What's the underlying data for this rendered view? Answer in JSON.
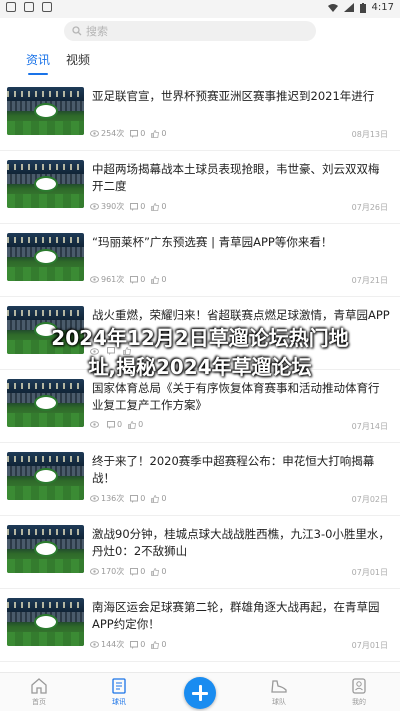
{
  "statusbar": {
    "time": "4:17"
  },
  "search": {
    "placeholder": "搜索"
  },
  "tabs": [
    {
      "label": "资讯"
    },
    {
      "label": "视频"
    }
  ],
  "articles": [
    {
      "title": "亚足联官宣，世界杯预赛亚洲区赛事推迟到2021年进行",
      "views": "254次",
      "comments": "0",
      "likes": "0",
      "date": "08月13日"
    },
    {
      "title": "中超两场揭幕战本土球员表现抢眼，韦世豪、刘云双双梅开二度",
      "views": "390次",
      "comments": "0",
      "likes": "0",
      "date": "07月26日"
    },
    {
      "title": "“玛丽莱杯”广东预选赛 | 青草园APP等你来看！",
      "views": "961次",
      "comments": "0",
      "likes": "0",
      "date": "07月21日"
    },
    {
      "title": "战火重燃，荣耀归来！省超联赛点燃足球激情，青草园APP",
      "views": "",
      "comments": "",
      "likes": "",
      "date": ""
    },
    {
      "title": "国家体育总局《关于有序恢复体育赛事和活动推动体育行业复工复产工作方案》",
      "views": "",
      "comments": "0",
      "likes": "0",
      "date": "07月14日"
    },
    {
      "title": "终于来了！2020赛季中超赛程公布：申花恒大打响揭幕战！",
      "views": "136次",
      "comments": "0",
      "likes": "0",
      "date": "07月02日"
    },
    {
      "title": "激战90分钟，桂城点球大战战胜西樵，九江3-0小胜里水，丹灶0：2不敌狮山",
      "views": "170次",
      "comments": "0",
      "likes": "0",
      "date": "07月01日"
    },
    {
      "title": "南海区运会足球赛第二轮，群雄角逐大战再起，在青草园APP约定你！",
      "views": "144次",
      "comments": "0",
      "likes": "0",
      "date": "07月01日"
    }
  ],
  "overlay": {
    "text": "2024年12月2日草遛论坛热门地址,揭秘2024年草遛论坛"
  },
  "tabbar": [
    {
      "label": "首页",
      "icon": "home-icon"
    },
    {
      "label": "球讯",
      "icon": "news-icon"
    },
    {
      "label": "",
      "icon": "plus-icon"
    },
    {
      "label": "球队",
      "icon": "shoe-icon"
    },
    {
      "label": "我的",
      "icon": "profile-icon"
    }
  ],
  "colors": {
    "accent": "#1a73e8",
    "fab": "#1a8cf0"
  }
}
